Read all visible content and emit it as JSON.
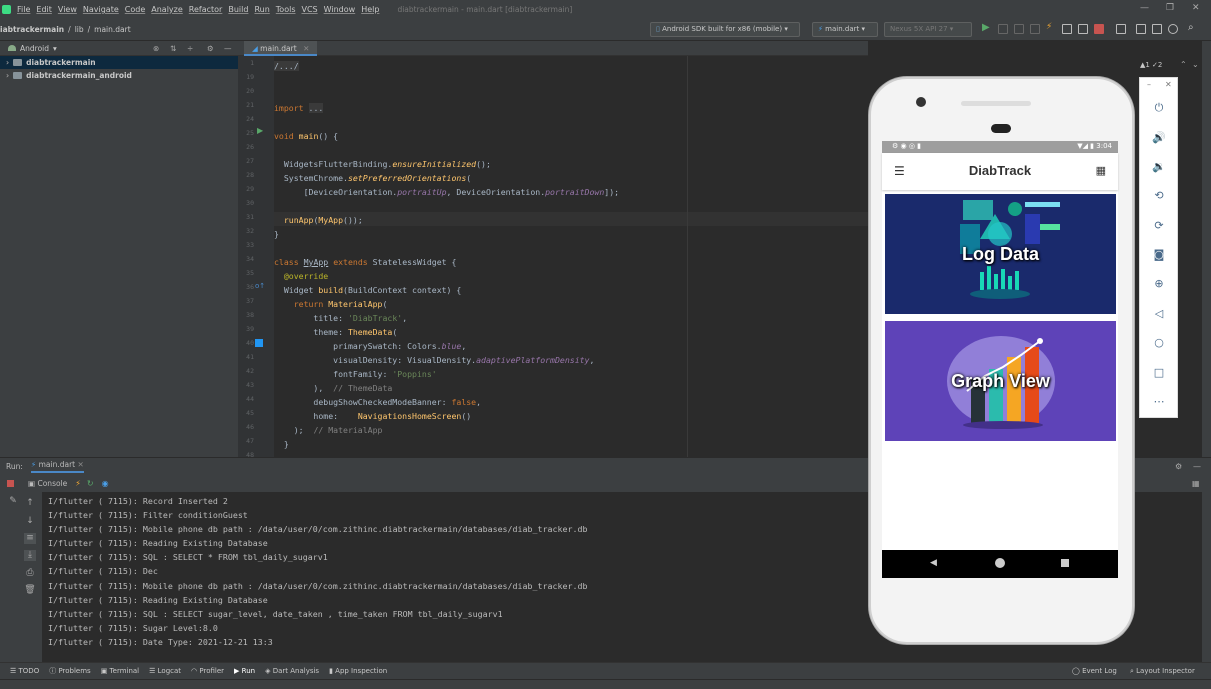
{
  "menu": {
    "items": [
      "File",
      "Edit",
      "View",
      "Navigate",
      "Code",
      "Analyze",
      "Refactor",
      "Build",
      "Run",
      "Tools",
      "VCS",
      "Window",
      "Help"
    ],
    "window_title": "diabtrackermain - main.dart [diabtrackermain]"
  },
  "navbar": {
    "breadcrumb": [
      "iabtrackermain",
      "lib",
      "main.dart"
    ],
    "device_combo": "Android SDK built for x86 (mobile)",
    "run_config": "main.dart",
    "avd_combo": "Nexus 5X API 27"
  },
  "project": {
    "view_label": "Android",
    "items": [
      "diabtrackermain",
      "diabtrackermain_android"
    ]
  },
  "editor": {
    "tab": "main.dart",
    "inspection": "▲1 ✓2",
    "line_numbers": [
      "1",
      "19",
      "20",
      "21",
      "24",
      "25",
      "26",
      "27",
      "28",
      "29",
      "30",
      "31",
      "32",
      "33",
      "34",
      "35",
      "36",
      "37",
      "38",
      "39",
      "40",
      "41",
      "42",
      "43",
      "44",
      "45",
      "46",
      "47",
      "48"
    ]
  },
  "run": {
    "label": "Run:",
    "tab": "main.dart",
    "console_tab": "Console"
  },
  "console_lines": [
    "I/flutter ( 7115): Record Inserted 2",
    "I/flutter ( 7115): Filter conditionGuest",
    "I/flutter ( 7115): Mobile phone db path : /data/user/0/com.zithinc.diabtrackermain/databases/diab_tracker.db",
    "I/flutter ( 7115): Reading Existing Database",
    "I/flutter ( 7115): SQL : SELECT * FROM tbl_daily_sugarv1",
    "I/flutter ( 7115): Dec",
    "I/flutter ( 7115): Mobile phone db path : /data/user/0/com.zithinc.diabtrackermain/databases/diab_tracker.db",
    "I/flutter ( 7115): Reading Existing Database",
    "I/flutter ( 7115): SQL : SELECT sugar_level, date_taken , time_taken FROM tbl_daily_sugarv1",
    "I/flutter ( 7115): Sugar Level:8.0",
    "I/flutter ( 7115): Date Type: 2021-12-21 13:3"
  ],
  "bottom_tools": [
    "TODO",
    "Problems",
    "Terminal",
    "Logcat",
    "Profiler",
    "Run",
    "Dart Analysis",
    "App Inspection"
  ],
  "bottom_right": [
    "Event Log",
    "Layout Inspector"
  ],
  "phone": {
    "status_time": "3:04",
    "app_title": "DiabTrack",
    "card1_label": "Log Data",
    "card2_label": "Graph View"
  },
  "colors": {
    "ide_bg": "#2b2b2b",
    "panel_bg": "#3c3f41",
    "card1_bg": "#1a2a6c",
    "card2_bg": "#5e43b8",
    "accent": "#4a88c7"
  }
}
